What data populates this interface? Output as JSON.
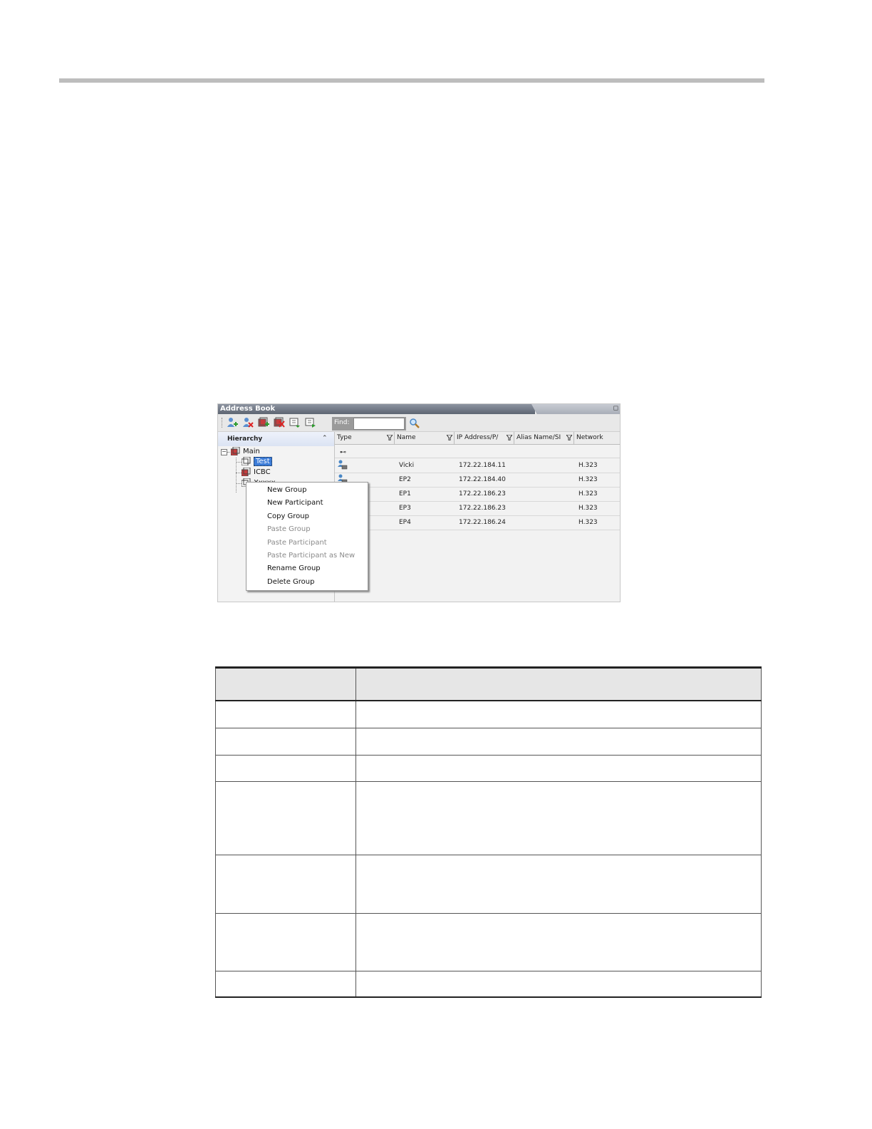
{
  "window": {
    "title": "Address Book"
  },
  "find": {
    "label": "Find:",
    "value": ""
  },
  "hierarchy": {
    "header": "Hierarchy",
    "root": "Main",
    "groups": [
      "Test",
      "ICBC",
      "Xxxxx"
    ]
  },
  "grid": {
    "columns": [
      "Type",
      "Name",
      "IP Address/P/",
      "Alias Name/SI",
      "Network"
    ],
    "rows": [
      {
        "name": "Vicki",
        "ip": "172.22.184.11",
        "alias": "",
        "network": "H.323"
      },
      {
        "name": "EP2",
        "ip": "172.22.184.40",
        "alias": "",
        "network": "H.323"
      },
      {
        "name": "EP1",
        "ip": "172.22.186.23",
        "alias": "",
        "network": "H.323"
      },
      {
        "name": "EP3",
        "ip": "172.22.186.23",
        "alias": "",
        "network": "H.323"
      },
      {
        "name": "EP4",
        "ip": "172.22.186.24",
        "alias": "",
        "network": "H.323"
      }
    ]
  },
  "context_menu": {
    "items": [
      {
        "label": "New Group",
        "enabled": true
      },
      {
        "label": "New Participant",
        "enabled": true
      },
      {
        "label": "Copy Group",
        "enabled": true
      },
      {
        "label": "Paste Group",
        "enabled": false
      },
      {
        "label": "Paste Participant",
        "enabled": false
      },
      {
        "label": "Paste Participant as New",
        "enabled": false
      },
      {
        "label": "Rename Group",
        "enabled": true
      },
      {
        "label": "Delete Group",
        "enabled": true
      }
    ]
  },
  "colors": {
    "selection": "#3c7cd8",
    "title_bar": "#5d6572",
    "table_header": "#e6e6e6"
  },
  "icons": [
    "add-participant-icon",
    "delete-participant-icon",
    "add-group-icon",
    "delete-group-icon",
    "import-icon",
    "export-icon",
    "search-icon",
    "group-icon",
    "endpoint-icon",
    "filter-icon"
  ]
}
